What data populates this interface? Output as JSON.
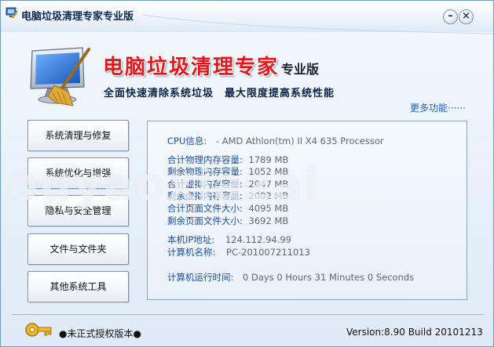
{
  "window": {
    "title": "电脑垃圾清理专家专业版",
    "minimize_symbol": "–",
    "close_symbol": "×"
  },
  "header": {
    "brand_title": "电脑垃圾清理专家",
    "edition": "专业版",
    "slogan": "全面快速清除系统垃圾　最大限度提高系统性能",
    "more_features": "更多功能······"
  },
  "nav": {
    "items": [
      {
        "label": "系统清理与修复"
      },
      {
        "label": "系统优化与增强"
      },
      {
        "label": "隐私与安全管理"
      },
      {
        "label": "文件与文件夹"
      },
      {
        "label": "其他系统工具"
      }
    ]
  },
  "info": {
    "cpu": {
      "label": "CPU信息:",
      "value": "- AMD Athlon(tm) II X4 635 Processor"
    },
    "mem_total_physical": {
      "label": "合计物理内存容量:",
      "value": "1789 MB"
    },
    "mem_free_physical": {
      "label": "剩余物理内存容量:",
      "value": "1052 MB"
    },
    "mem_total_virtual": {
      "label": "合计虚拟内存容量:",
      "value": "2047 MB"
    },
    "mem_free_virtual": {
      "label": "剩余虚拟内存容量:",
      "value": "2002 MB"
    },
    "page_total": {
      "label": "合计页面文件大小:",
      "value": "4095 MB"
    },
    "page_free": {
      "label": "剩余页面文件大小:",
      "value": "3692 MB"
    },
    "ip": {
      "label": "本机IP地址:",
      "value": "124.112.94.99"
    },
    "computer_name": {
      "label": "计算机名称:",
      "value": "PC-201007211013"
    },
    "uptime": {
      "label": "计算机运行时间:",
      "value": "0 Days 0 Hours 31 Minutes 0 Seconds"
    }
  },
  "watermark": "ouyaoxiazai",
  "footer": {
    "license": "●未正式授权版本●",
    "version": "Version:8.90 Build 20101213"
  },
  "colors": {
    "accent": "#1f4ea3",
    "brand_red": "#e8161b",
    "panel_border": "#8aa5c6"
  },
  "icons": [
    "app-icon",
    "minimize-icon",
    "close-icon",
    "monitor-broom-icon",
    "key-icon"
  ]
}
